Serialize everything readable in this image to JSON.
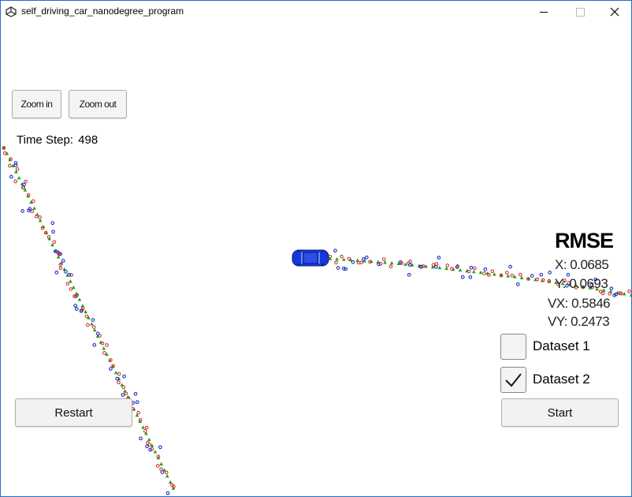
{
  "window": {
    "title": "self_driving_car_nanodegree_program",
    "app_icon": "unity-icon",
    "controls": [
      "minimize-icon",
      "maximize-icon",
      "close-icon"
    ]
  },
  "toolbar": {
    "zoom_in": "Zoom in",
    "zoom_out": "Zoom out"
  },
  "status": {
    "time_step_label": "Time Step:",
    "time_step_value": "498"
  },
  "rmse": {
    "title": "RMSE",
    "x": "X: 0.0685",
    "y": "Y: 0.0693",
    "vx": "VX: 0.5846",
    "vy": "VY: 0.2473"
  },
  "datasets": [
    {
      "label": "Dataset 1",
      "checked": false
    },
    {
      "label": "Dataset 2",
      "checked": true
    }
  ],
  "buttons": {
    "restart": "Restart",
    "start": "Start"
  },
  "colors": {
    "ground_truth": "#18a518",
    "lidar": "#d42020",
    "radar": "#1a2fd0",
    "car": "#1538d6"
  }
}
